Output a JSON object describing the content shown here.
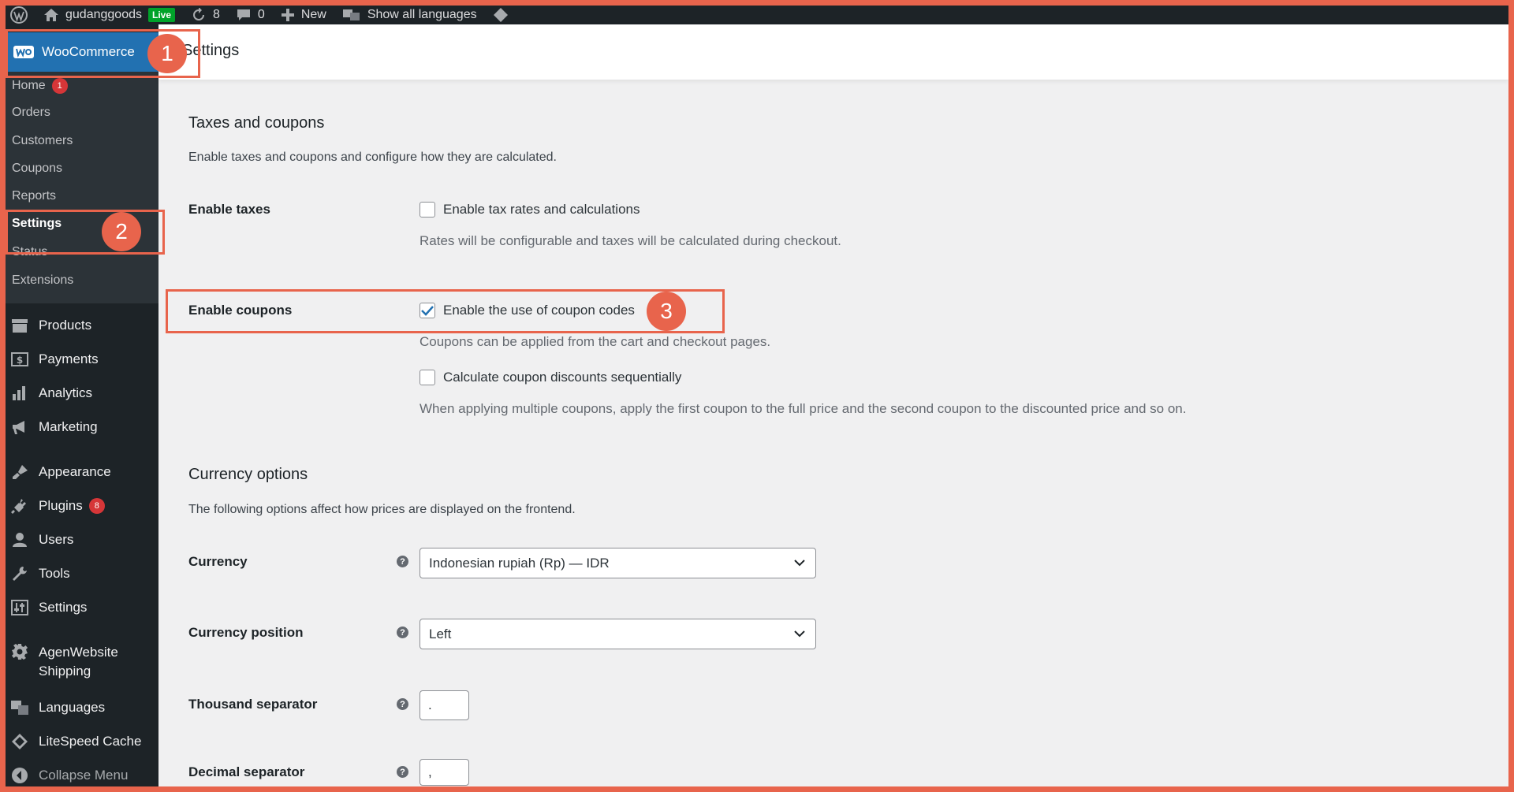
{
  "adminbar": {
    "site_name": "gudanggoods",
    "live_badge": "Live",
    "updates_count": "8",
    "comments_count": "0",
    "new_label": "New",
    "languages_label": "Show all languages"
  },
  "sidebar": {
    "woocommerce_label": "WooCommerce",
    "submenu": [
      {
        "label": "Home",
        "badge": "1"
      },
      {
        "label": "Orders"
      },
      {
        "label": "Customers"
      },
      {
        "label": "Coupons"
      },
      {
        "label": "Reports"
      },
      {
        "label": "Settings"
      },
      {
        "label": "Status"
      },
      {
        "label": "Extensions"
      }
    ],
    "menu": [
      {
        "label": "Products",
        "icon": "archive-icon"
      },
      {
        "label": "Payments",
        "icon": "dollar-icon"
      },
      {
        "label": "Analytics",
        "icon": "bar-chart-icon"
      },
      {
        "label": "Marketing",
        "icon": "megaphone-icon"
      },
      {
        "label": "Appearance",
        "icon": "brush-icon"
      },
      {
        "label": "Plugins",
        "icon": "plug-icon",
        "badge": "8"
      },
      {
        "label": "Users",
        "icon": "user-icon"
      },
      {
        "label": "Tools",
        "icon": "wrench-icon"
      },
      {
        "label": "Settings",
        "icon": "sliders-icon"
      },
      {
        "label": "AgenWebsite Shipping",
        "icon": "gear-icon"
      },
      {
        "label": "Languages",
        "icon": "translate-icon"
      },
      {
        "label": "LiteSpeed Cache",
        "icon": "diamond-icon"
      },
      {
        "label": "Collapse Menu",
        "icon": "collapse-icon"
      }
    ]
  },
  "header": {
    "title": "Settings"
  },
  "taxes": {
    "heading": "Taxes and coupons",
    "description": "Enable taxes and coupons and configure how they are calculated.",
    "enable_taxes": {
      "label": "Enable taxes",
      "checkbox_label": "Enable tax rates and calculations",
      "checked": false,
      "help": "Rates will be configurable and taxes will be calculated during checkout."
    },
    "enable_coupons": {
      "label": "Enable coupons",
      "checkbox_label": "Enable the use of coupon codes",
      "checked": true,
      "help": "Coupons can be applied from the cart and checkout pages."
    },
    "sequential": {
      "checkbox_label": "Calculate coupon discounts sequentially",
      "checked": false,
      "help": "When applying multiple coupons, apply the first coupon to the full price and the second coupon to the discounted price and so on."
    }
  },
  "currency": {
    "heading": "Currency options",
    "description": "The following options affect how prices are displayed on the frontend.",
    "help_tip_glyph": "?",
    "currency_field": {
      "label": "Currency",
      "value": "Indonesian rupiah (Rp) — IDR"
    },
    "position_field": {
      "label": "Currency position",
      "value": "Left"
    },
    "thousand_field": {
      "label": "Thousand separator",
      "value": "."
    },
    "decimal_field": {
      "label": "Decimal separator",
      "value": ","
    }
  },
  "annotations": {
    "step1": "1",
    "step2": "2",
    "step3": "3",
    "highlight_color": "#e8644c"
  },
  "colors": {
    "admin_dark": "#1d2327",
    "admin_blue": "#2271b1",
    "badge_red": "#d63638",
    "live_green": "#00a32a"
  }
}
